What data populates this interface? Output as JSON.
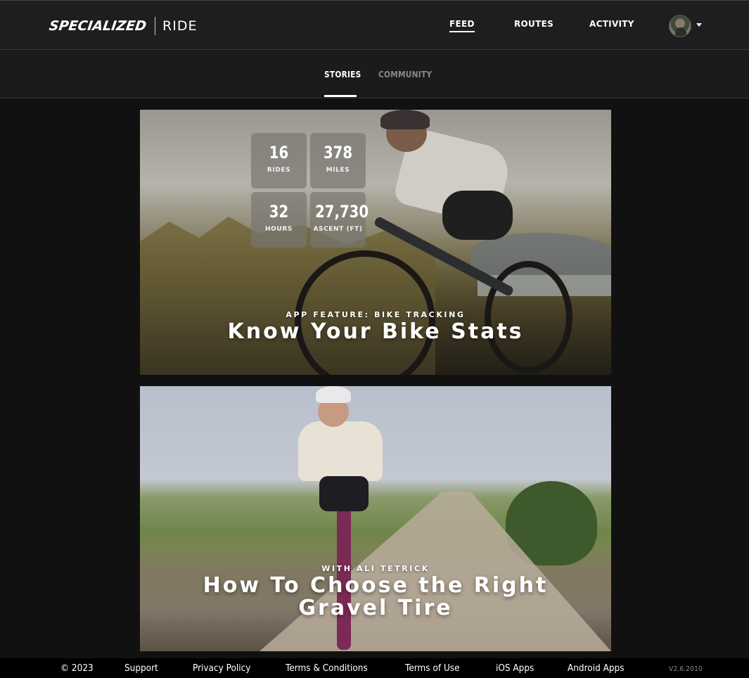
{
  "header": {
    "brand_logo": "SPECIALIZED",
    "brand_sub": "RIDE",
    "nav": [
      {
        "label": "FEED",
        "active": true
      },
      {
        "label": "ROUTES",
        "active": false
      },
      {
        "label": "ACTIVITY",
        "active": false
      }
    ],
    "avatar_icon": "user-avatar",
    "menu_icon": "caret-down-icon"
  },
  "tabs": [
    {
      "label": "STORIES",
      "active": true
    },
    {
      "label": "COMMUNITY",
      "active": false
    }
  ],
  "stories": [
    {
      "eyebrow": "APP FEATURE: BIKE TRACKING",
      "title": "Know Your Bike Stats",
      "stats": [
        {
          "value": "16",
          "label": "RIDES"
        },
        {
          "value": "378",
          "label": "MILES"
        },
        {
          "value": "32",
          "label": "HOURS"
        },
        {
          "value": "27,730",
          "label": "ASCENT (FT)"
        }
      ]
    },
    {
      "eyebrow": "WITH ALI TETRICK",
      "title": "How To Choose the Right Gravel Tire"
    }
  ],
  "footer": {
    "copyright": "© 2023",
    "links": [
      "Support",
      "Privacy Policy",
      "Terms & Conditions",
      "Terms of Use",
      "iOS Apps",
      "Android Apps"
    ],
    "version": "V2.6.2010"
  },
  "colors": {
    "background": "#111111",
    "header": "#1e1e1e",
    "subbar": "#1b1b1b",
    "inactive_tab": "#888888",
    "footer": "#000000"
  }
}
